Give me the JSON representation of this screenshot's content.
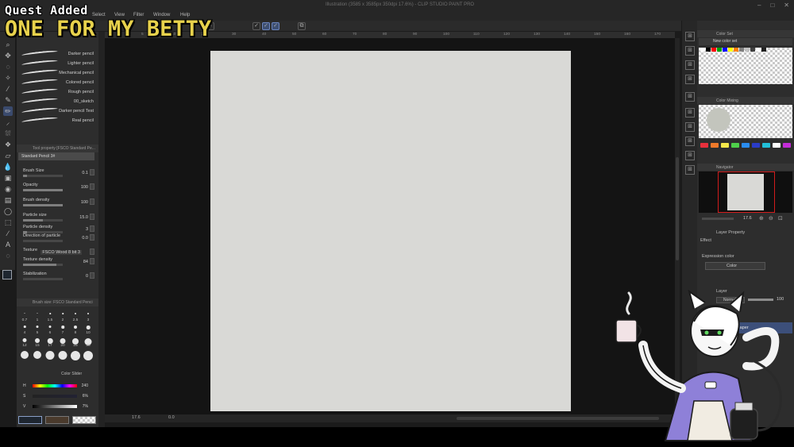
{
  "overlay": {
    "quest_added": "Quest Added",
    "quest_title": "ONE FOR MY BETTY"
  },
  "window": {
    "title": "Illustration (3585 x 3585px 350dpi 17.6%) - CLIP STUDIO PAINT PRO"
  },
  "menu": [
    "Select",
    "View",
    "Filter",
    "Window",
    "Help"
  ],
  "brushes": [
    "Darker pencil",
    "Lighter pencil",
    "Mechanical pencil",
    "Colored pencil",
    "Rough pencil",
    "00_sketch",
    "Darker pencil Test",
    "Real pencil"
  ],
  "tool_property": {
    "header": "Tool property [FSCO Standard Pe...",
    "preset": "Standard Pencil 3#",
    "rows": [
      {
        "label": "Brush Size",
        "value": "0.1",
        "fill": 0.1
      },
      {
        "label": "Opacity",
        "value": "100",
        "fill": 1.0
      },
      {
        "label": "Brush density",
        "value": "100",
        "fill": 1.0
      },
      {
        "label": "Particle size",
        "value": "15.0",
        "fill": 0.5
      },
      {
        "label": "Particle density",
        "value": "3",
        "fill": 0.1
      },
      {
        "label": "Direction of particle",
        "value": "0.0",
        "fill": 0.0
      },
      {
        "label": "Texture",
        "value": "FSCO Wood 8 bit 3",
        "fill": 0.0
      },
      {
        "label": "Texture density",
        "value": "84",
        "fill": 0.84
      },
      {
        "label": "Stabilization",
        "value": "0",
        "fill": 0.0
      }
    ]
  },
  "brush_size_panel": {
    "header": "Brush size: FSCO Standard Penci",
    "sizes": [
      "0.7",
      "1",
      "1.5",
      "2",
      "2.5",
      "3",
      "4",
      "5",
      "6",
      "7",
      "8",
      "10",
      "12",
      "15",
      "17",
      "20",
      "25",
      "30",
      "40",
      "50",
      "60",
      "70",
      "80",
      "100"
    ],
    "color_slider_label": "Color Slider"
  },
  "hsv": [
    {
      "label": "H",
      "value": "240"
    },
    {
      "label": "S",
      "value": "6%"
    },
    {
      "label": "V",
      "value": "7%"
    }
  ],
  "ruler": [
    "0",
    "5",
    "10",
    "20",
    "30",
    "40",
    "50",
    "60",
    "70",
    "80",
    "90",
    "100",
    "110",
    "120",
    "130",
    "140",
    "150",
    "160",
    "170"
  ],
  "status": {
    "zoom": "17.6",
    "rotation": "0.0"
  },
  "right_panel": {
    "color_set": "Color Set",
    "color_set_name": "New color set",
    "color_mixing": "Color Mixing",
    "navigator": "Navigator",
    "nav_zoom": "17.6",
    "layer_property": "Layer Property",
    "effect": "Effect",
    "expression_color": "Expression color",
    "expression_value": "Color",
    "layer": "Layer",
    "blend_mode": "Normal",
    "opacity": "100",
    "layer_name": "Paper"
  },
  "colors": {
    "canvas": "#d9d9d6",
    "accent": "#3c4f7a",
    "quest_yellow": "#e8d24c"
  }
}
